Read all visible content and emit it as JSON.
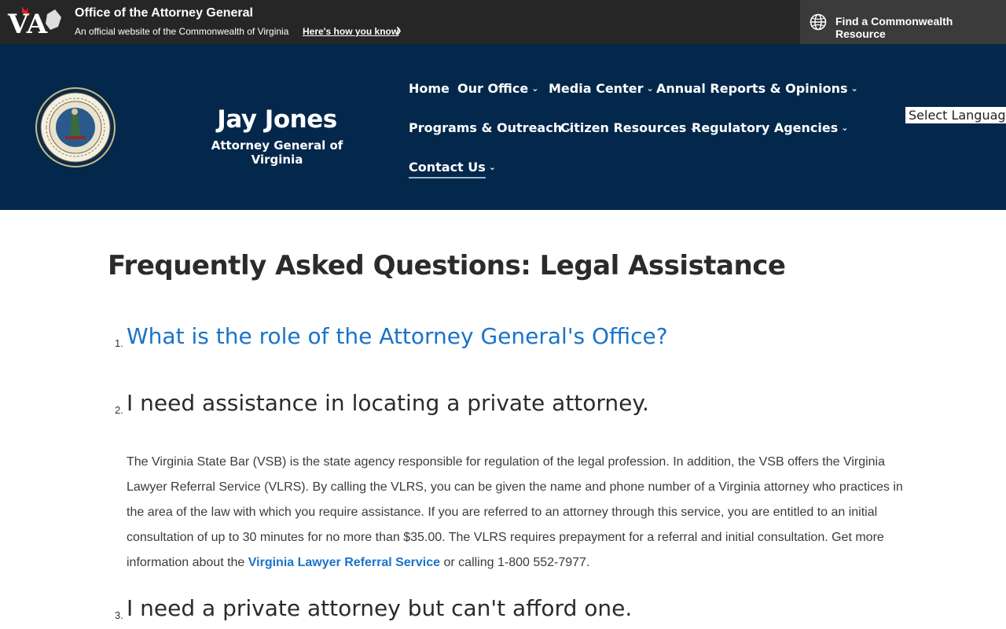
{
  "topbar": {
    "logo_text": "VA",
    "title": "Office of the Attorney General",
    "subtitle": "An official website of the Commonwealth of Virginia",
    "how_know": "Here's how you know",
    "find_resource": "Find a Commonwealth Resource"
  },
  "header": {
    "name": "Jay Jones",
    "title": "Attorney General of Virginia",
    "nav": [
      {
        "label": "Home"
      },
      {
        "label": "Our Office"
      },
      {
        "label": "Media Center"
      },
      {
        "label": "Annual Reports & Opinions"
      },
      {
        "label": "Programs & Outreach"
      },
      {
        "label": "Citizen Resources"
      },
      {
        "label": "Regulatory Agencies"
      },
      {
        "label": "Contact Us"
      }
    ],
    "language": "Select Language"
  },
  "content": {
    "title": "Frequently Asked Questions: Legal Assistance",
    "questions": [
      {
        "num": "1.",
        "text": "What is the role of the Attorney General's Office?"
      },
      {
        "num": "2.",
        "text": "I need assistance in locating a private attorney."
      },
      {
        "num": "3.",
        "text": "I need a private attorney but can't afford one."
      }
    ],
    "answer2": {
      "before": "The Virginia State Bar (VSB) is the state agency responsible for regulation of the legal profession. In addition, the VSB offers the Virginia Lawyer Referral Service (VLRS). By calling the VLRS, you can be given the name and phone number of a Virginia attorney who practices in the area of the law with which you require assistance. If you are referred to an attorney through this service, you are entitled to an initial consultation of up to 30 minutes for no more than $35.00. The VLRS requires prepayment for a referral and initial consultation.  Get more information about the ",
      "link": "Virginia Lawyer Referral Service",
      "after": " or calling 1-800 552-7977."
    }
  },
  "colors": {
    "topbar_bg": "#262626",
    "header_bg": "#03284b",
    "link": "#1a73c9"
  }
}
